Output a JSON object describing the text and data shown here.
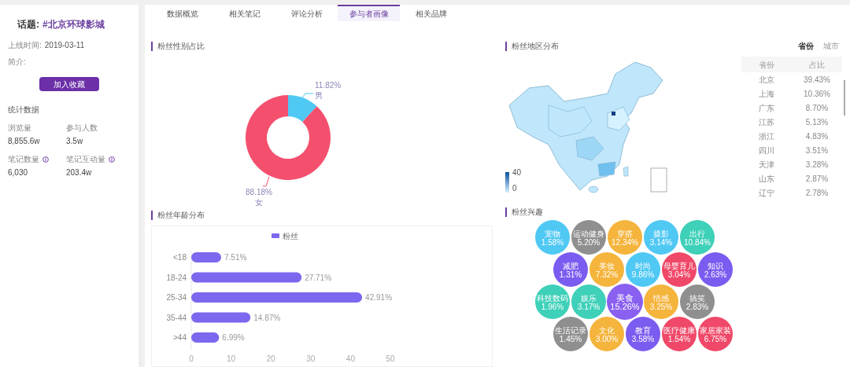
{
  "sidebar": {
    "title_label": "话题:",
    "topic": "#北京环球影城",
    "meta": [
      {
        "label": "上线时间:",
        "value": "2019-03-11"
      },
      {
        "label": "简介:"
      }
    ],
    "collect_button": "加入收藏",
    "stats_heading": "统计数据",
    "stats": [
      {
        "label": "浏览量",
        "value": "8,855.6w",
        "info": false
      },
      {
        "label": "参与人数",
        "value": "3.5w",
        "info": false
      },
      {
        "label": "笔记数量",
        "value": "6,030",
        "info": true
      },
      {
        "label": "笔记互动量",
        "value": "203.4w",
        "info": true
      }
    ]
  },
  "tabs": [
    {
      "label": "数据概览",
      "selected": false
    },
    {
      "label": "相关笔记",
      "selected": false
    },
    {
      "label": "评论分析",
      "selected": false
    },
    {
      "label": "参与者画像",
      "selected": true
    },
    {
      "label": "相关品牌",
      "selected": false
    }
  ],
  "gender": {
    "title": "粉丝性别占比",
    "chart_data": {
      "type": "donut",
      "categories": [
        "男",
        "女"
      ],
      "values": [
        11.82,
        88.18
      ],
      "value_labels": [
        "11.82%",
        "88.18%"
      ]
    }
  },
  "region": {
    "title": "粉丝地区分布",
    "legend_max": "40",
    "legend_min": "0",
    "toggle": [
      {
        "label": "省份",
        "selected": true
      },
      {
        "label": "城市",
        "selected": false
      }
    ],
    "columns": [
      "省份",
      "占比"
    ],
    "rows": [
      [
        "北京",
        "39.43%"
      ],
      [
        "上海",
        "10.36%"
      ],
      [
        "广东",
        "8.70%"
      ],
      [
        "江苏",
        "5.13%"
      ],
      [
        "浙江",
        "4.83%"
      ],
      [
        "四川",
        "3.51%"
      ],
      [
        "天津",
        "3.28%"
      ],
      [
        "山东",
        "2.87%"
      ],
      [
        "辽宁",
        "2.78%"
      ]
    ]
  },
  "age": {
    "title": "粉丝年龄分布",
    "chart_data": {
      "type": "bar",
      "orientation": "horizontal",
      "categories": [
        "<18",
        "18-24",
        "25-34",
        "35-44",
        ">44"
      ],
      "series": [
        {
          "name": "粉丝",
          "color": "#7b68ee",
          "values": [
            7.51,
            27.71,
            42.91,
            14.87,
            6.99
          ]
        }
      ],
      "value_labels": [
        "7.51%",
        "27.71%",
        "42.91%",
        "14.87%",
        "6.99%"
      ],
      "xlim": [
        0,
        50
      ],
      "xticks": [
        0,
        10,
        20,
        30,
        40,
        50
      ]
    }
  },
  "interests": {
    "title": "粉丝兴趣",
    "bubbles": [
      {
        "label": "宠物",
        "value": "1.58%",
        "color": "#4fc8f4"
      },
      {
        "label": "运动健身",
        "value": "5.20%",
        "color": "#8f8f8f"
      },
      {
        "label": "穿搭",
        "value": "12.34%",
        "color": "#f5b43c"
      },
      {
        "label": "摄影",
        "value": "3.14%",
        "color": "#4fc8f4"
      },
      {
        "label": "出行",
        "value": "10.84%",
        "color": "#3ed0b8"
      },
      {
        "label": "减肥",
        "value": "1.31%",
        "color": "#7b5cf0"
      },
      {
        "label": "美妆",
        "value": "7.32%",
        "color": "#f5b43c"
      },
      {
        "label": "时尚",
        "value": "9.86%",
        "color": "#4fc8f4"
      },
      {
        "label": "母婴育儿",
        "value": "3.04%",
        "color": "#f04868"
      },
      {
        "label": "知识",
        "value": "2.63%",
        "color": "#7b5cf0"
      },
      {
        "label": "科技数码",
        "value": "1.96%",
        "color": "#3ed0b8"
      },
      {
        "label": "娱乐",
        "value": "3.17%",
        "color": "#3ed0b8"
      },
      {
        "label": "美食",
        "value": "15.26%",
        "color": "#8a60f0"
      },
      {
        "label": "情感",
        "value": "3.25%",
        "color": "#f5b43c"
      },
      {
        "label": "搞笑",
        "value": "2.83%",
        "color": "#8f8f8f"
      },
      {
        "label": "生活记录",
        "value": "1.45%",
        "color": "#8f8f8f"
      },
      {
        "label": "文化",
        "value": "3.00%",
        "color": "#f5b43c"
      },
      {
        "label": "教育",
        "value": "3.58%",
        "color": "#7b5cf0"
      },
      {
        "label": "医疗健康",
        "value": "1.54%",
        "color": "#f04868"
      },
      {
        "label": "家居家装",
        "value": "6.75%",
        "color": "#f04868"
      }
    ]
  }
}
